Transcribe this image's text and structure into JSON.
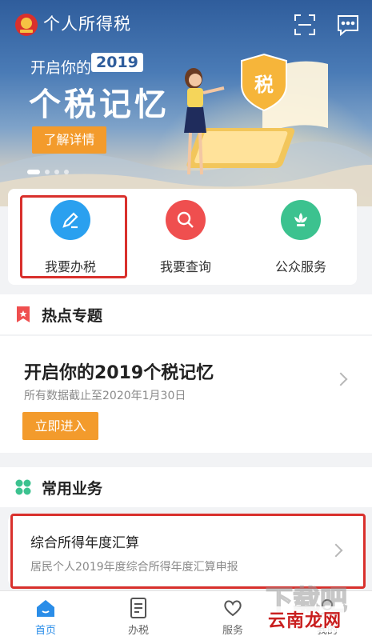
{
  "header": {
    "app_title": "个人所得税"
  },
  "banner": {
    "line1": "开启你的",
    "year": "2019",
    "title": "个税记忆",
    "button_label": "了解详情",
    "shield_text": "税",
    "page_count": 4,
    "active_index": 0
  },
  "actions": [
    {
      "label": "我要办税",
      "icon": "pen-icon",
      "color": "#2aa0ef"
    },
    {
      "label": "我要查询",
      "icon": "search-icon",
      "color": "#ef4f4f"
    },
    {
      "label": "公众服务",
      "icon": "flower-icon",
      "color": "#3cc28f"
    }
  ],
  "hot_topics": {
    "section_title": "热点专题",
    "card_title": "开启你的2019个税记忆",
    "card_subtitle": "所有数据截止至2020年1月30日",
    "button_label": "立即进入"
  },
  "common_business": {
    "section_title": "常用业务",
    "item_title": "综合所得年度汇算",
    "item_subtitle": "居民个人2019年度综合所得年度汇算申报"
  },
  "bottom_nav": [
    {
      "label": "首页",
      "icon": "home-icon",
      "active": true
    },
    {
      "label": "办税",
      "icon": "tax-form-icon",
      "active": false
    },
    {
      "label": "服务",
      "icon": "heart-hand-icon",
      "active": false
    },
    {
      "label": "我的",
      "icon": "user-icon",
      "active": false
    }
  ],
  "watermark": {
    "text": "云南龙网",
    "logo_text": "下载吧"
  },
  "colors": {
    "accent": "#2a8de8",
    "orange": "#f39b2c",
    "highlight": "#d9302c"
  }
}
